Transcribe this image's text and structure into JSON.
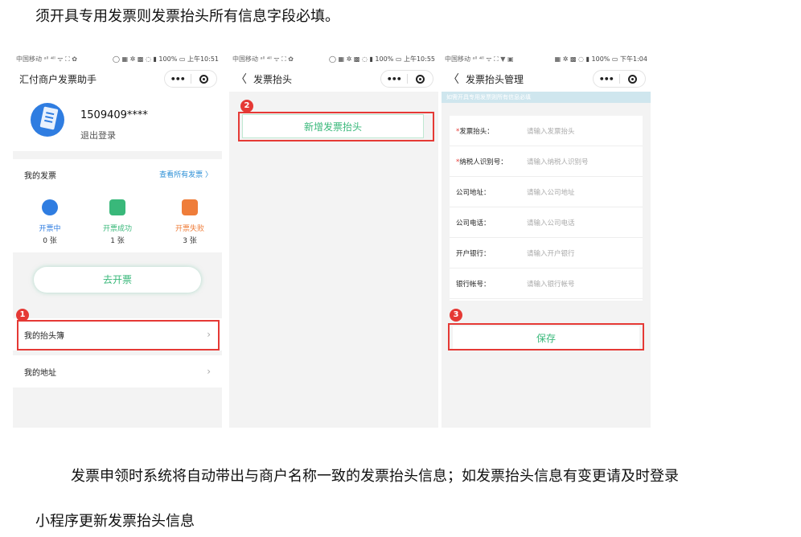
{
  "doc": {
    "top_text": "须开具专用发票则发票抬头所有信息字段必填。",
    "bottom_line1": "发票申领时系统将自动带出与商户名称一致的发票抬头信息；如发票抬头信息有变更请及时登录",
    "bottom_line2": "小程序更新发票抬头信息"
  },
  "phone1": {
    "status_left": "中国移动 ᵃˡˡ ⁴ˡˡ ᯤ ⛶ ✿",
    "status_right": "◯ ▦ ✲ ▩ ◌ ▮ 100% ▭ 上午10:51",
    "nav_title": "汇付商户发票助手",
    "capsule_dots": "•••",
    "user_phone": "1509409****",
    "logout": "退出登录",
    "my_invoices": "我的发票",
    "view_all": "查看所有发票 〉",
    "stats": [
      {
        "label": "开票中",
        "count": "0 张",
        "color": "#2f7de1",
        "icon": "clock-icon"
      },
      {
        "label": "开票成功",
        "count": "1 张",
        "color": "#39b87a",
        "icon": "receipt-success-icon"
      },
      {
        "label": "开票失败",
        "count": "3 张",
        "color": "#ef7d3a",
        "icon": "receipt-fail-icon"
      }
    ],
    "go_invoice": "去开票",
    "badge": "1",
    "header_book": "我的抬头簿",
    "address": "我的地址",
    "chevron": "›"
  },
  "phone2": {
    "status_left": "中国移动 ᵃˡˡ ⁴ˡˡ ᯤ ⛶ ✿",
    "status_right": "◯ ▦ ✲ ▩ ◌ ▮ 100% ▭ 上午10:55",
    "back": "〈",
    "nav_title": "发票抬头",
    "capsule_dots": "•••",
    "badge": "2",
    "add_header": "新增发票抬头"
  },
  "phone3": {
    "status_left": "中国移动 ᵃˡˡ ⁴ˡˡ ᯤ ⛶ ▼ ▣",
    "status_right": "▦ ✲ ▩ ◌ ▮ 100% ▭ 下午1:04",
    "back": "〈",
    "nav_title": "发票抬头管理",
    "capsule_dots": "•••",
    "hint": "如需开具专用发票则所有信息必填",
    "fields": [
      {
        "label": "发票抬头：",
        "placeholder": "请输入发票抬头",
        "required": true
      },
      {
        "label": "纳税人识别号：",
        "placeholder": "请输入纳税人识别号",
        "required": true
      },
      {
        "label": "公司地址：",
        "placeholder": "请输入公司地址",
        "required": false
      },
      {
        "label": "公司电话：",
        "placeholder": "请输入公司电话",
        "required": false
      },
      {
        "label": "开户银行：",
        "placeholder": "请输入开户银行",
        "required": false
      },
      {
        "label": "银行帐号：",
        "placeholder": "请输入银行帐号",
        "required": false
      }
    ],
    "required_mark": "*",
    "badge": "3",
    "save": "保存"
  }
}
